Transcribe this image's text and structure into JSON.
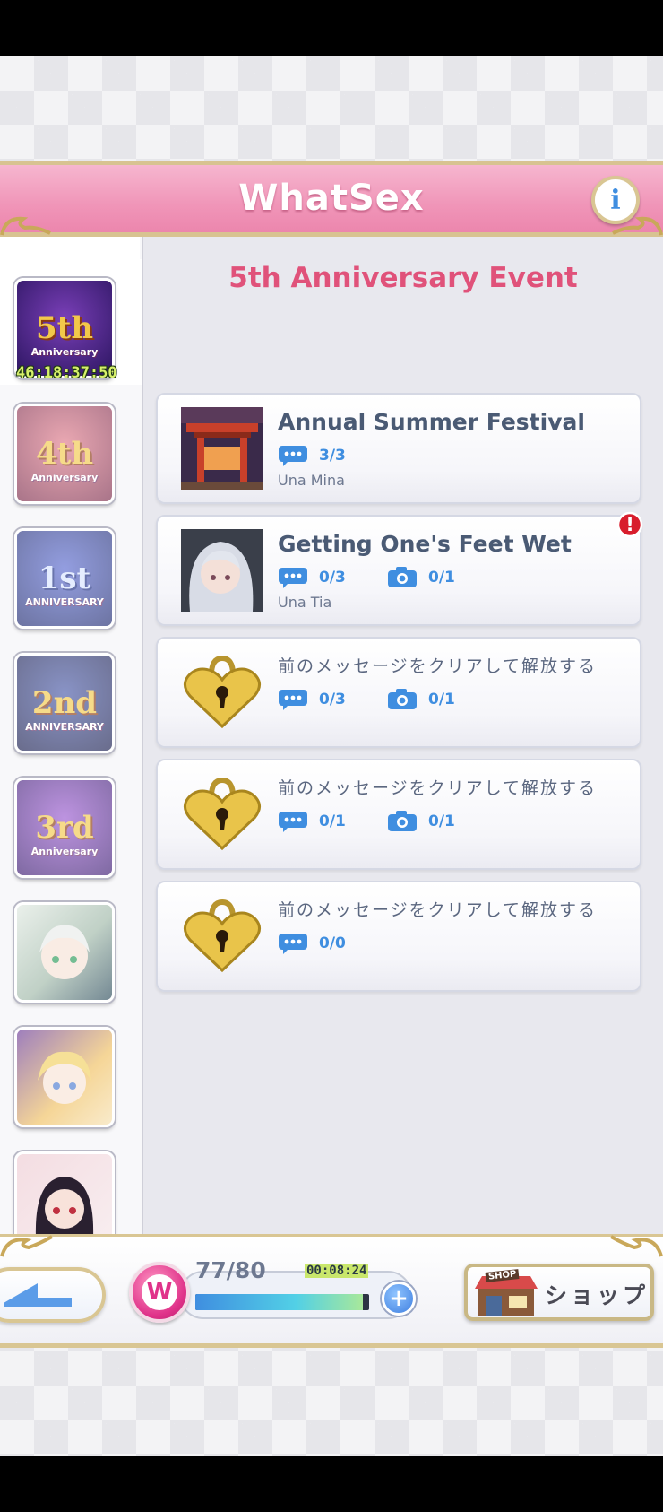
{
  "header": {
    "title": "WhatSex",
    "info_label": "i"
  },
  "sidebar": {
    "timer": "46:18:37:50",
    "items": [
      {
        "label": "5th",
        "sub": "Anniversary"
      },
      {
        "label": "4th",
        "sub": "Anniversary"
      },
      {
        "label": "1st",
        "sub": "ANNIVERSARY"
      },
      {
        "label": "2nd",
        "sub": "ANNIVERSARY"
      },
      {
        "label": "3rd",
        "sub": "Anniversary"
      },
      {
        "label": "",
        "sub": ""
      },
      {
        "label": "",
        "sub": ""
      },
      {
        "label": "",
        "sub": ""
      }
    ]
  },
  "main": {
    "event_title": "5th Anniversary Event",
    "cards": [
      {
        "title": "Annual Summer Festival",
        "messages": "3/3",
        "photos": "",
        "character": "Una Mina"
      },
      {
        "title": "Getting One's Feet Wet",
        "messages": "0/3",
        "photos": "0/1",
        "character": "Una Tia",
        "alert": "!"
      },
      {
        "note": "前のメッセージをクリアして解放する",
        "messages": "0/3",
        "photos": "0/1"
      },
      {
        "note": "前のメッセージをクリアして解放する",
        "messages": "0/1",
        "photos": "0/1"
      },
      {
        "note": "前のメッセージをクリアして解放する",
        "messages": "0/0",
        "photos": ""
      }
    ]
  },
  "footer": {
    "stamina": "77/80",
    "stamina_fraction": 0.9625,
    "stamina_timer": "00:08:24",
    "badge_letter": "W",
    "plus_label": "+",
    "shop_sign": "SHOP",
    "shop_label": "ショップ"
  },
  "colors": {
    "accent_pink": "#e0527a",
    "stat_blue": "#3f8ee0",
    "gold_trim": "#d9c693"
  }
}
